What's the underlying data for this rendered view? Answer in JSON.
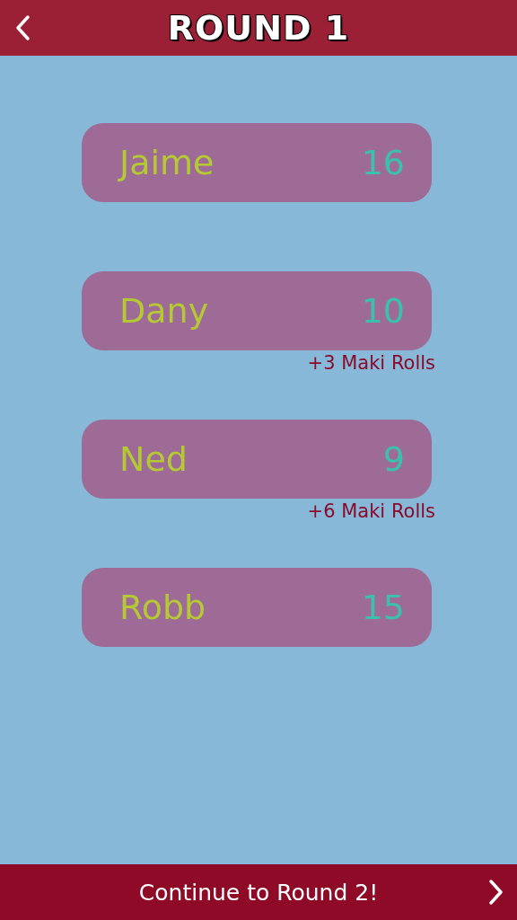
{
  "header": {
    "title": "ROUND 1"
  },
  "players": [
    {
      "name": "Jaime",
      "score": "16"
    },
    {
      "name": "Dany",
      "score": "10",
      "bonus": "+3 Maki Rolls"
    },
    {
      "name": "Ned",
      "score": "9",
      "bonus": "+6 Maki Rolls"
    },
    {
      "name": "Robb",
      "score": "15"
    }
  ],
  "footer": {
    "label": "Continue to Round 2!"
  }
}
